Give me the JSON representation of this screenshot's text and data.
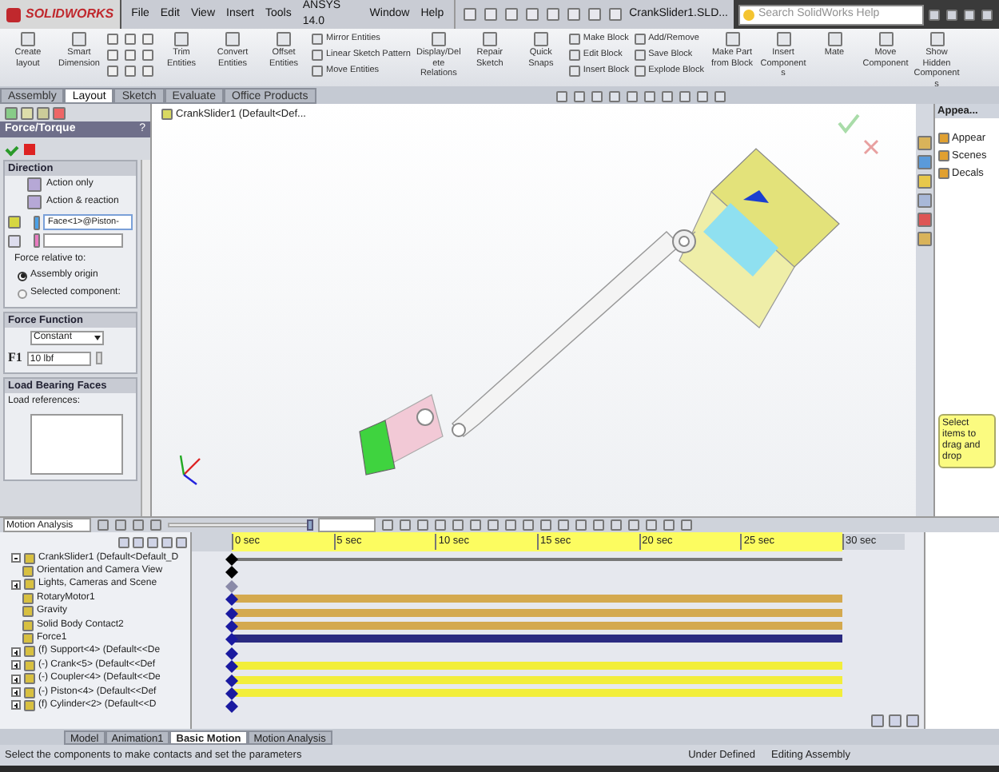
{
  "title_bar": {
    "logo": "SOLIDWORKS",
    "menus": [
      "File",
      "Edit",
      "View",
      "Insert",
      "Tools",
      "ANSYS 14.0",
      "Window",
      "Help"
    ],
    "document": "CrankSlider1.SLD...",
    "search": {
      "placeholder": "Search SolidWorks Help"
    }
  },
  "ribbon": [
    {
      "kind": "large",
      "label": "Create layout"
    },
    {
      "kind": "large",
      "label": "Smart Dimension"
    },
    {
      "kind": "tools"
    },
    {
      "kind": "large",
      "label": "Trim Entities"
    },
    {
      "kind": "large",
      "label": "Convert Entities"
    },
    {
      "kind": "large",
      "label": "Offset Entities"
    },
    {
      "kind": "stack",
      "items": [
        "Mirror Entities",
        "Linear Sketch Pattern",
        "Move Entities"
      ]
    },
    {
      "kind": "large",
      "label": "Display/Delete Relations"
    },
    {
      "kind": "large",
      "label": "Repair Sketch"
    },
    {
      "kind": "large",
      "label": "Quick Snaps"
    },
    {
      "kind": "stack",
      "items": [
        "Make Block",
        "Edit Block",
        "Insert Block"
      ]
    },
    {
      "kind": "stack",
      "items": [
        "Add/Remove",
        "Save Block",
        "Explode Block"
      ]
    },
    {
      "kind": "large",
      "label": "Make Part from Block"
    },
    {
      "kind": "large",
      "label": "Insert Components"
    },
    {
      "kind": "large",
      "label": "Mate"
    },
    {
      "kind": "large",
      "label": "Move Component"
    },
    {
      "kind": "large",
      "label": "Show Hidden Components"
    }
  ],
  "tabs": [
    {
      "label": "Assembly",
      "selected": false
    },
    {
      "label": "Layout",
      "selected": true
    },
    {
      "label": "Sketch",
      "selected": false
    },
    {
      "label": "Evaluate",
      "selected": false
    },
    {
      "label": "Office Products",
      "selected": false
    }
  ],
  "property_manager": {
    "title": "Force/Torque",
    "help": "?",
    "direction": {
      "title": "Direction",
      "options": [
        "Action only",
        "Action & reaction"
      ],
      "face_field": "Face<1>@Piston-",
      "relative_label": "Force relative to:",
      "radios": [
        {
          "label": "Assembly origin",
          "selected": true
        },
        {
          "label": "Selected component:",
          "selected": false
        }
      ]
    },
    "force_function": {
      "title": "Force Function",
      "function": "Constant",
      "symbol": "F1",
      "value": "10 lbf"
    },
    "load_faces": {
      "title": "Load Bearing Faces",
      "label": "Load references:"
    }
  },
  "graphics": {
    "tree_root": "CrankSlider1  (Default<Def..."
  },
  "task_pane": {
    "title": "Appea...",
    "items": [
      "Appear",
      "Scenes",
      "Decals"
    ],
    "hint": "Select items to drag and drop"
  },
  "motion": {
    "study_type": "Motion Analysis",
    "playback": {
      "level": 1
    },
    "ticks": [
      "0 sec",
      "5 sec",
      "10 sec",
      "15 sec",
      "20 sec",
      "25 sec",
      "30 sec"
    ],
    "rows": [
      {
        "label": "CrankSlider1  (Default<Default_D",
        "expanded": true,
        "kind": "line",
        "key": {
          "color": "#000000"
        }
      },
      {
        "label": "Orientation and Camera View",
        "kind": "key",
        "key": {
          "color": "#000000"
        }
      },
      {
        "label": "Lights, Cameras and Scene",
        "expanded": false,
        "kind": "key",
        "key": {
          "color": "#8a8aa8"
        }
      },
      {
        "label": "RotaryMotor1",
        "kind": "bar",
        "color": "#d4a94e",
        "key": {
          "color": "#1a1aa0"
        }
      },
      {
        "label": "Gravity",
        "kind": "bar",
        "color": "#d4a94e",
        "key": {
          "color": "#1a1aa0"
        }
      },
      {
        "label": "Solid Body Contact2",
        "kind": "bar",
        "color": "#d4a94e",
        "key": {
          "color": "#1a1aa0"
        }
      },
      {
        "label": "Force1",
        "kind": "bar",
        "color": "#2a2a80",
        "key": {
          "color": "#1a1aa0"
        }
      },
      {
        "label": "(f) Support<4>  (Default<<De",
        "expanded": false,
        "kind": "key",
        "key": {
          "color": "#1a1aa0"
        }
      },
      {
        "label": "(-) Crank<5>  (Default<<Def",
        "expanded": false,
        "kind": "bar",
        "color": "#f2ee3a",
        "key": {
          "color": "#1a1aa0"
        }
      },
      {
        "label": "(-) Coupler<4>  (Default<<De",
        "expanded": false,
        "kind": "bar",
        "color": "#f2ee3a",
        "key": {
          "color": "#1a1aa0"
        }
      },
      {
        "label": "(-) Piston<4>  (Default<<Def",
        "expanded": false,
        "kind": "bar",
        "color": "#f2ee3a",
        "key": {
          "color": "#1a1aa0"
        }
      },
      {
        "label": "(f) Cylinder<2>  (Default<<D",
        "expanded": false,
        "kind": "key",
        "key": {
          "color": "#1a1aa0"
        }
      }
    ]
  },
  "bottom_tabs": [
    {
      "label": "Model",
      "selected": false
    },
    {
      "label": "Animation1",
      "selected": false
    },
    {
      "label": "Basic Motion",
      "selected": true
    },
    {
      "label": "Motion Analysis",
      "selected": false
    }
  ],
  "status_bar": {
    "message": "Select the components to make contacts and set the parameters",
    "state": "Under Defined",
    "mode": "Editing Assembly"
  }
}
